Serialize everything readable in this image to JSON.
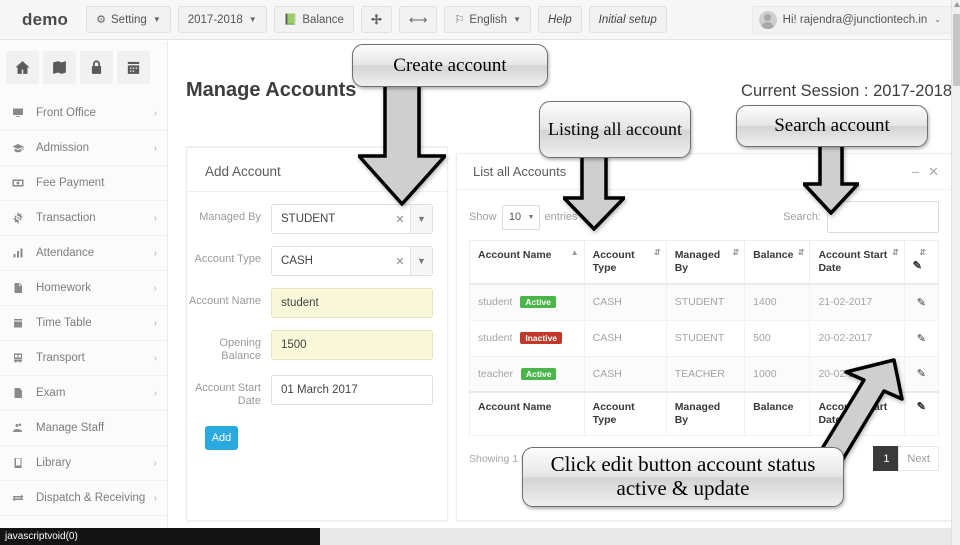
{
  "topbar": {
    "brand": "demo",
    "buttons": [
      {
        "label": "Setting",
        "icon": "gear-icon",
        "caret": true
      },
      {
        "label": "2017-2018",
        "icon": "",
        "caret": true
      },
      {
        "label": "Balance",
        "icon": "book-icon",
        "caret": false
      },
      {
        "label": "",
        "icon": "compress-icon",
        "caret": false
      },
      {
        "label": "",
        "icon": "expand-icon",
        "caret": false
      },
      {
        "label": "English",
        "icon": "flag-icon",
        "caret": true
      },
      {
        "label": "Help",
        "icon": "",
        "caret": false
      },
      {
        "label": "Initial setup",
        "icon": "",
        "caret": false
      }
    ],
    "user": "Hi! rajendra@junctiontech.in"
  },
  "sidebar": {
    "quick_icons": [
      "home-icon",
      "language-icon",
      "lock-icon",
      "calendar-icon"
    ],
    "items": [
      {
        "label": "Front Office",
        "icon": "monitor-icon",
        "arrow": "›"
      },
      {
        "label": "Admission",
        "icon": "graduation-cap-icon",
        "arrow": "›"
      },
      {
        "label": "Fee Payment",
        "icon": "money-icon",
        "arrow": ""
      },
      {
        "label": "Transaction",
        "icon": "gear-icon",
        "arrow": "›"
      },
      {
        "label": "Attendance",
        "icon": "bar-chart-icon",
        "arrow": "›"
      },
      {
        "label": "Homework",
        "icon": "file-icon",
        "arrow": "›"
      },
      {
        "label": "Time Table",
        "icon": "calendar-icon",
        "arrow": "›"
      },
      {
        "label": "Transport",
        "icon": "bus-icon",
        "arrow": "›"
      },
      {
        "label": "Exam",
        "icon": "document-icon",
        "arrow": "›"
      },
      {
        "label": "Manage Staff",
        "icon": "users-icon",
        "arrow": ""
      },
      {
        "label": "Library",
        "icon": "book-icon",
        "arrow": "›"
      },
      {
        "label": "Dispatch & Receiving",
        "icon": "exchange-icon",
        "arrow": "›"
      }
    ]
  },
  "page": {
    "title": "Manage Accounts",
    "session": "Current Session : 2017-2018"
  },
  "add_account": {
    "heading": "Add Account",
    "fields": [
      {
        "label": "Managed By",
        "type": "select",
        "value": "STUDENT",
        "highlight": false
      },
      {
        "label": "Account Type",
        "type": "select",
        "value": "CASH",
        "highlight": false
      },
      {
        "label": "Account Name",
        "type": "input",
        "value": "student",
        "highlight": true
      },
      {
        "label": "Opening Balance",
        "type": "input",
        "value": "1500",
        "highlight": true
      },
      {
        "label": "Account Start Date",
        "type": "input",
        "value": "01 March 2017",
        "highlight": false
      }
    ],
    "submit_label": "Add"
  },
  "list_panel": {
    "title": "List all Accounts",
    "minimize_icon": "–",
    "close_icon": "✕",
    "show_label": "Show",
    "show_value": "10",
    "entries_label": "entries",
    "search_label": "Search:",
    "search_value": "",
    "columns": [
      "Account Name",
      "Account Type",
      "Managed By",
      "Balance",
      "Account Start Date",
      ""
    ],
    "rows": [
      {
        "name": "student",
        "status": "Active",
        "type": "CASH",
        "managed_by": "STUDENT",
        "balance": "1400",
        "start_date": "21-02-2017",
        "edit_icon": "edit-icon"
      },
      {
        "name": "student",
        "status": "Inactive",
        "type": "CASH",
        "managed_by": "STUDENT",
        "balance": "500",
        "start_date": "20-02-2017",
        "edit_icon": "edit-icon"
      },
      {
        "name": "teacher",
        "status": "Active",
        "type": "CASH",
        "managed_by": "TEACHER",
        "balance": "1000",
        "start_date": "20-02-2017",
        "edit_icon": "edit-icon"
      }
    ],
    "footer_columns": [
      "Account Name",
      "Account Type",
      "Managed By",
      "Balance",
      "Account Start Date",
      ""
    ],
    "showing_text": "Showing 1 to",
    "pager": [
      "1",
      "Next"
    ],
    "pager_active": "1"
  },
  "callouts": [
    {
      "text": "Create account",
      "id": "create-account-callout"
    },
    {
      "text": "Listing all account",
      "id": "listing-all-account-callout"
    },
    {
      "text": "Search account",
      "id": "search-account-callout"
    },
    {
      "text": "Click edit button account status active & update",
      "id": "click-edit-button-callout"
    }
  ],
  "status_bar": {
    "text": "javascriptvoid(0)"
  },
  "colors": {
    "accent": "#2aa8e0",
    "active_badge": "#4ab64a",
    "inactive_badge": "#c0392b",
    "highlight_field": "#f9f8d8"
  }
}
